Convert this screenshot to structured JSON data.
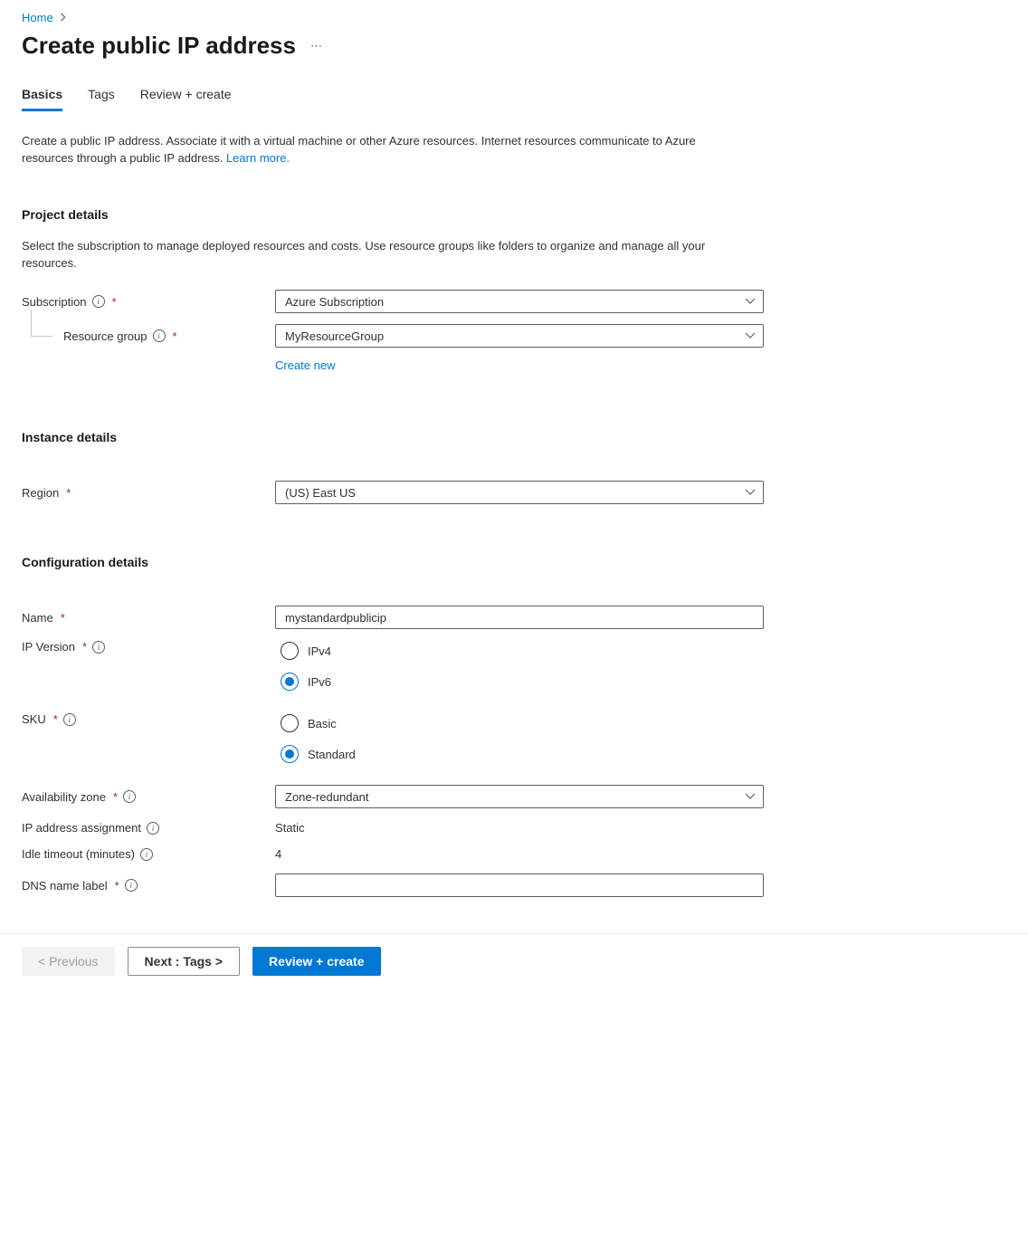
{
  "breadcrumb": {
    "home": "Home"
  },
  "title": "Create public IP address",
  "tabs": {
    "basics": "Basics",
    "tags": "Tags",
    "review": "Review + create"
  },
  "intro": {
    "text": "Create a public IP address. Associate it with a virtual machine or other Azure resources. Internet resources communicate to Azure resources through a public IP address. ",
    "learn_more": "Learn more."
  },
  "sections": {
    "project": {
      "title": "Project details",
      "desc": "Select the subscription to manage deployed resources and costs. Use resource groups like folders to organize and manage all your resources.",
      "subscription_label": "Subscription",
      "subscription_value": "Azure Subscription",
      "resource_group_label": "Resource group",
      "resource_group_value": "MyResourceGroup",
      "create_new": "Create new"
    },
    "instance": {
      "title": "Instance details",
      "region_label": "Region",
      "region_value": "(US) East US"
    },
    "config": {
      "title": "Configuration details",
      "name_label": "Name",
      "name_value": "mystandardpublicip",
      "ip_version_label": "IP Version",
      "ip_version_options": {
        "ipv4": "IPv4",
        "ipv6": "IPv6"
      },
      "sku_label": "SKU",
      "sku_options": {
        "basic": "Basic",
        "standard": "Standard"
      },
      "az_label": "Availability zone",
      "az_value": "Zone-redundant",
      "ip_assign_label": "IP address assignment",
      "ip_assign_value": "Static",
      "idle_label": "Idle timeout (minutes)",
      "idle_value": "4",
      "dns_label": "DNS name label",
      "dns_value": ""
    }
  },
  "footer": {
    "previous": "< Previous",
    "next": "Next : Tags >",
    "review": "Review + create"
  }
}
